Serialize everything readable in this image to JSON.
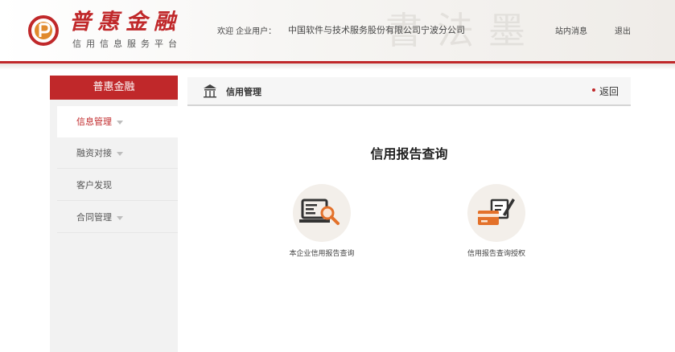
{
  "header": {
    "logo_title": "普惠金融",
    "logo_subtitle": "信用信息服务平台",
    "welcome_label": "欢迎 企业用户：",
    "company_name": "中国软件与技术服务股份有限公司宁波分公司",
    "messages_label": "站内消息",
    "logout_label": "退出",
    "accent_color": "#c0282a"
  },
  "sidebar": {
    "title": "普惠金融",
    "items": [
      {
        "label": "信息管理",
        "active": true,
        "expandable": true
      },
      {
        "label": "融资对接",
        "active": false,
        "expandable": true
      },
      {
        "label": "客户发现",
        "active": false,
        "expandable": false
      },
      {
        "label": "合同管理",
        "active": false,
        "expandable": true
      }
    ]
  },
  "breadcrumb": {
    "icon": "building-icon",
    "title": "信用管理",
    "back_label": "返回"
  },
  "main": {
    "title": "信用报告查询",
    "tiles": [
      {
        "label": "本企业信用报告查询",
        "icon": "computer-search-icon"
      },
      {
        "label": "信用报告查询授权",
        "icon": "card-sign-icon"
      }
    ]
  }
}
